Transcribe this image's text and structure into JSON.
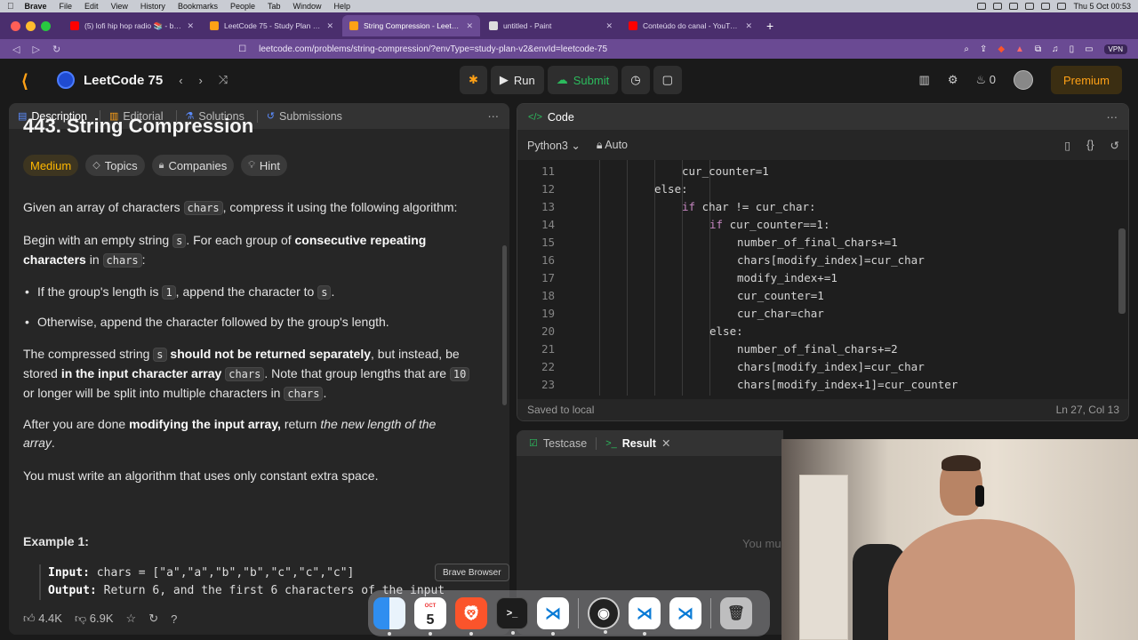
{
  "menubar": {
    "app": "Brave",
    "items": [
      "File",
      "Edit",
      "View",
      "History",
      "Bookmarks",
      "People",
      "Tab",
      "Window",
      "Help"
    ],
    "clock": "Thu 5 Oct  00:53"
  },
  "browser": {
    "tabs": [
      {
        "label": "(5) lofi hip hop radio 📚 - beats",
        "active": false,
        "color": "#ff0000"
      },
      {
        "label": "LeetCode 75 - Study Plan - LeetCo",
        "active": false,
        "color": "#ffa116"
      },
      {
        "label": "String Compression - LeetCode",
        "active": true,
        "color": "#ffa116"
      },
      {
        "label": "untitled - Paint",
        "active": false,
        "color": "#dddddd"
      },
      {
        "label": "Conteúdo do canal - YouTube Studi",
        "active": false,
        "color": "#ff0000"
      }
    ],
    "url": "leetcode.com/problems/string-compression/?envType=study-plan-v2&envId=leetcode-75",
    "vpn": "VPN"
  },
  "lc": {
    "study_title": "LeetCode 75",
    "run_label": "Run",
    "submit_label": "Submit",
    "streak": "0",
    "premium_label": "Premium"
  },
  "left": {
    "tabs": [
      "Description",
      "Editorial",
      "Solutions",
      "Submissions"
    ],
    "title": "443. String Compression",
    "chips": [
      "Medium",
      "Topics",
      "Companies",
      "Hint"
    ],
    "p1_a": "Given an array of characters ",
    "p1_code": "chars",
    "p1_b": ", compress it using the following algorithm:",
    "p2_a": "Begin with an empty string ",
    "p2_code": "s",
    "p2_b": ". For each group of ",
    "p2_bold": "consecutive repeating",
    "p2_bold2": "characters",
    "p2_c": " in ",
    "p2_code2": "chars",
    "p2_d": ":",
    "b1_a": "If the group's length is ",
    "b1_code": "1",
    "b1_b": ", append the character to ",
    "b1_code2": "s",
    "b1_c": ".",
    "b2": "Otherwise, append the character followed by the group's length.",
    "p3_a": "The compressed string ",
    "p3_code": "s",
    "p3_bold": "should not be returned separately",
    "p3_b": ", but instead, be",
    "p3_c": "stored ",
    "p3_bold2": "in the input character array",
    "p3_code2": "chars",
    "p3_d": ". Note that group lengths that are ",
    "p3_code3": "10",
    "p3_e": "or longer will be split into multiple characters in ",
    "p3_code4": "chars",
    "p3_f": ".",
    "p4_a": "After you are done ",
    "p4_bold": "modifying the input array,",
    "p4_b": " return ",
    "p4_it": "the new length of the",
    "p4_it2": "array",
    "p4_c": ".",
    "p5": "You must write an algorithm that uses only constant extra space.",
    "example_title": "Example 1:",
    "ex_input_label": "Input:",
    "ex_input": "chars = [\"a\",\"a\",\"b\",\"b\",\"c\",\"c\",\"c\"]",
    "ex_output_label": "Output:",
    "ex_output": "Return 6, and the first 6 characters of the input",
    "likes": "4.4K",
    "dislikes": "6.9K"
  },
  "code": {
    "header": "Code",
    "language": "Python3",
    "auto": "Auto",
    "status_left": "Saved to local",
    "status_right": "Ln 27, Col 13",
    "lines": [
      {
        "n": "11",
        "indent": 4,
        "text": "cur_counter=1"
      },
      {
        "n": "12",
        "indent": 3,
        "text": "else:",
        "kw": true
      },
      {
        "n": "13",
        "indent": 4,
        "text": "if char != cur_char:",
        "kwprefix": "if"
      },
      {
        "n": "14",
        "indent": 5,
        "text": "if cur_counter==1:",
        "kwprefix": "if"
      },
      {
        "n": "15",
        "indent": 6,
        "text": "number_of_final_chars+=1"
      },
      {
        "n": "16",
        "indent": 6,
        "text": "chars[modify_index]=cur_char"
      },
      {
        "n": "17",
        "indent": 6,
        "text": "modify_index+=1"
      },
      {
        "n": "18",
        "indent": 6,
        "text": "cur_counter=1"
      },
      {
        "n": "19",
        "indent": 6,
        "text": "cur_char=char"
      },
      {
        "n": "20",
        "indent": 5,
        "text": "else:",
        "kw": true
      },
      {
        "n": "21",
        "indent": 6,
        "text": "number_of_final_chars+=2"
      },
      {
        "n": "22",
        "indent": 6,
        "text": "chars[modify_index]=cur_char"
      },
      {
        "n": "23",
        "indent": 6,
        "text": "chars[modify_index+1]=cur_counter"
      }
    ]
  },
  "testcase": {
    "tab1": "Testcase",
    "tab2": "Result",
    "message": "You mu"
  },
  "dock": {
    "tooltip": "Brave Browser",
    "cal_month": "OCT",
    "cal_day": "5"
  }
}
